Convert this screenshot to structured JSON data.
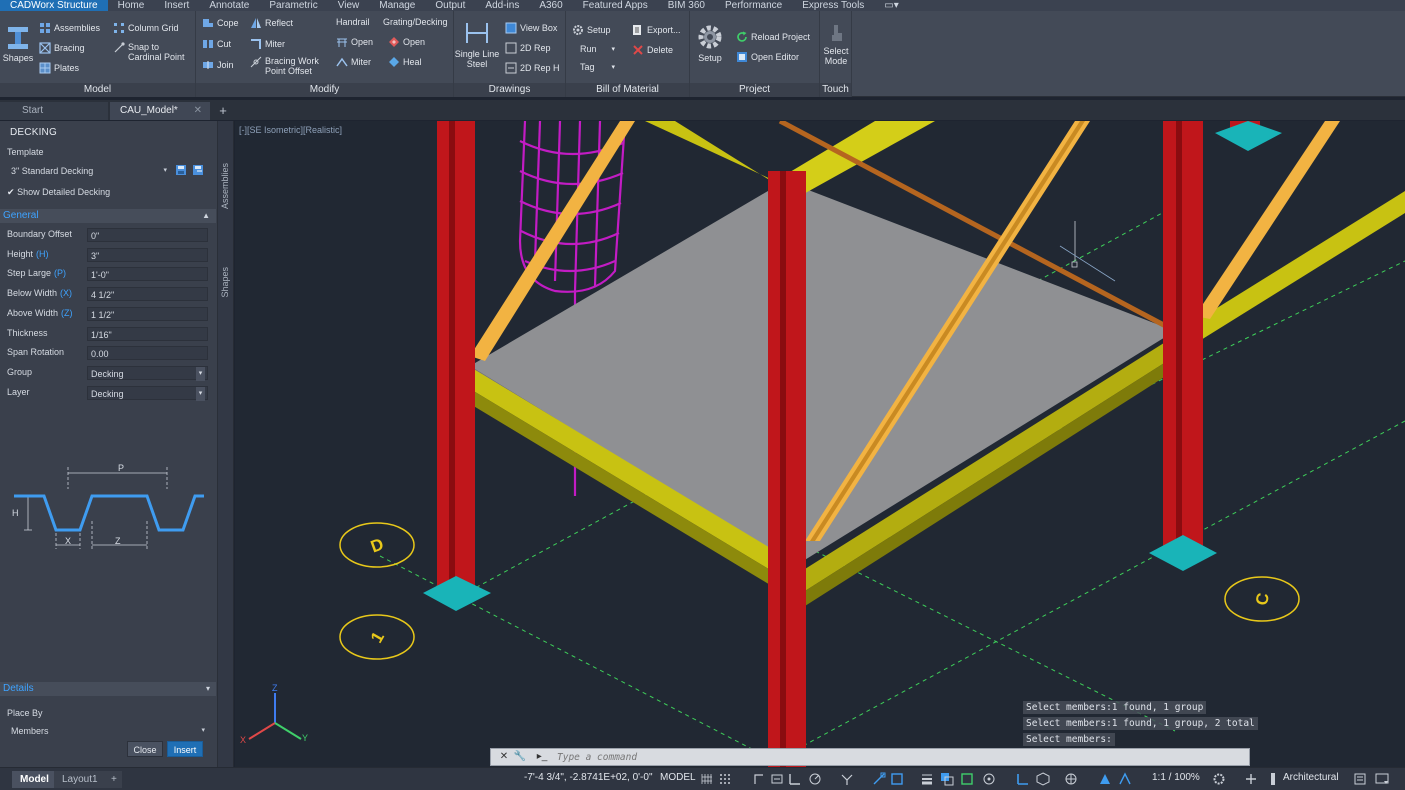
{
  "ribbon": {
    "tabs": [
      "CADWorx Structure",
      "Home",
      "Insert",
      "Annotate",
      "Parametric",
      "View",
      "Manage",
      "Output",
      "Add-ins",
      "A360",
      "Featured Apps",
      "BIM 360",
      "Performance",
      "Express Tools"
    ],
    "active_tab": "CADWorx Structure",
    "panels": {
      "model": {
        "title": "Model",
        "shapes": "Shapes",
        "assemblies": "Assemblies",
        "bracing": "Bracing",
        "plates": "Plates",
        "column_grid": "Column Grid",
        "snap_to_cardinal_point": "Snap to\nCardinal Point"
      },
      "modify": {
        "title": "Modify",
        "cope": "Cope",
        "cut": "Cut",
        "join": "Join",
        "reflect": "Reflect",
        "miter": "Miter",
        "bracing_work_point_offset": "Bracing Work\nPoint Offset",
        "handrail_label": "Handrail",
        "handrail_open": "Open",
        "handrail_miter": "Miter",
        "grating_label": "Grating/Decking",
        "grating_open": "Open",
        "grating_heal": "Heal"
      },
      "drawings": {
        "title": "Drawings",
        "single_line_steel": "Single Line\nSteel",
        "view_box": "View Box",
        "rep_2d": "2D Rep",
        "rep_2d_h": "2D Rep H"
      },
      "bom": {
        "title": "Bill of Material",
        "setup": "Setup",
        "run": "Run",
        "tag": "Tag",
        "export": "Export...",
        "delete": "Delete"
      },
      "project": {
        "title": "Project",
        "setup": "Setup",
        "reload_project": "Reload Project",
        "open_editor": "Open Editor"
      },
      "touch": {
        "title": "Touch",
        "select_mode": "Select\nMode"
      }
    }
  },
  "doc_tabs": {
    "start": "Start",
    "model": "CAU_Model*"
  },
  "palette": {
    "title": "DECKING",
    "template_label": "Template",
    "template_value": "3\" Standard Decking",
    "show_detailed_decking": "Show Detailed Decking",
    "side_tabs": [
      "Assemblies",
      "Shapes"
    ],
    "general_header": "General",
    "properties": [
      {
        "label": "Boundary Offset",
        "key": "",
        "value": "0\""
      },
      {
        "label": "Height",
        "key": "(H)",
        "value": "3\""
      },
      {
        "label": "Step Large",
        "key": "(P)",
        "value": "1'-0\""
      },
      {
        "label": "Below Width",
        "key": "(X)",
        "value": "4 1/2\""
      },
      {
        "label": "Above Width",
        "key": "(Z)",
        "value": "1 1/2\""
      },
      {
        "label": "Thickness",
        "key": "",
        "value": "1/16\""
      },
      {
        "label": "Span Rotation",
        "key": "",
        "value": "0.00"
      },
      {
        "label": "Group",
        "key": "",
        "value": "Decking"
      },
      {
        "label": "Layer",
        "key": "",
        "value": "Decking"
      }
    ],
    "diagram_labels": {
      "p": "P",
      "h": "H",
      "x": "X",
      "z": "Z"
    },
    "details_header": "Details",
    "place_by_label": "Place By",
    "place_by_value": "Members",
    "close_button": "Close",
    "insert_button": "Insert"
  },
  "viewport": {
    "label": "[-][SE Isometric][Realistic]",
    "grid_bubbles": [
      "D",
      "1",
      "C"
    ],
    "axis_labels": {
      "x": "X",
      "y": "Y",
      "z": "Z"
    },
    "command_history": [
      "Select members:1 found, 1 group",
      "Select members:1 found, 1 group, 2 total",
      "Select members:"
    ],
    "command_placeholder": "Type a command"
  },
  "statusbar": {
    "layout_tabs": [
      "Model",
      "Layout1"
    ],
    "coords": "-7'-4 3/4\", -2.8741E+02, 0'-0\"",
    "model": "MODEL",
    "scale": "1:1 / 100%",
    "units": "Architectural"
  },
  "colors": {
    "accent": "#1f6fb5",
    "column_red": "#c0161b",
    "beam_yellow": "#c8c212",
    "brace_orange": "#f2b342",
    "deck_gray": "#8f9093",
    "ladder_magenta": "#c21cc4",
    "baseplate_cyan": "#19b4b8",
    "grid_green": "#3ecf5a",
    "bubble_yellow": "#e8c81a"
  }
}
